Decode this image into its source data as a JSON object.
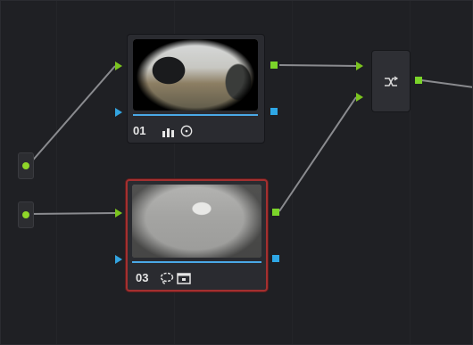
{
  "colors": {
    "background": "#1f2024",
    "node_bg": "#2a2b30",
    "selected_outline": "#a33030",
    "rgb_port": "#7bd42a",
    "alpha_port": "#2ea7e6",
    "link": "#8a8b8f"
  },
  "nodes": [
    {
      "label": "01",
      "icons": [
        "bars-icon",
        "circle-dot-icon"
      ],
      "selected": false
    },
    {
      "label": "03",
      "icons": [
        "lasso-icon",
        "window-icon"
      ],
      "selected": true
    }
  ],
  "inputs": [
    {
      "name": "source-input-1"
    },
    {
      "name": "source-input-2"
    }
  ],
  "combine_node": {
    "icon": "layer-mixer-icon"
  }
}
